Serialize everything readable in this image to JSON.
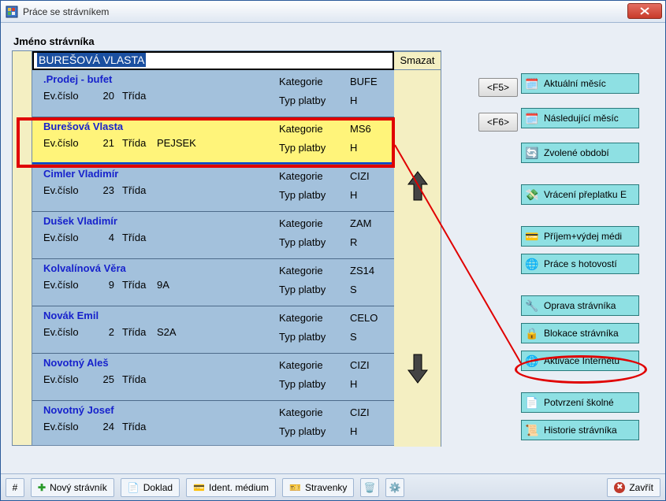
{
  "window": {
    "title": "Práce se strávníkem"
  },
  "sectionLabel": "Jméno strávníka",
  "searchValue": "BUREŠOVÁ VLASTA",
  "smazatLabel": "Smazat",
  "labels": {
    "ev": "Ev.číslo",
    "trida": "Třída",
    "kategorie": "Kategorie",
    "typplatby": "Typ platby"
  },
  "rows": [
    {
      "name": ".Prodej - bufet",
      "ev": "20",
      "trida": "",
      "kat": "BUFE",
      "typ": "H"
    },
    {
      "name": "Burešová Vlasta",
      "ev": "21",
      "trida": "PEJSEK",
      "kat": "MS6",
      "typ": "H",
      "selected": true
    },
    {
      "name": "Cimler Vladimír",
      "ev": "23",
      "trida": "",
      "kat": "CIZI",
      "typ": "H"
    },
    {
      "name": "Dušek Vladimír",
      "ev": "4",
      "trida": "",
      "kat": "ZAM",
      "typ": "R"
    },
    {
      "name": "Kolvalínová Věra",
      "ev": "9",
      "trida": "9A",
      "kat": "ZS14",
      "typ": "S"
    },
    {
      "name": "Novák Emil",
      "ev": "2",
      "trida": "S2A",
      "kat": "CELO",
      "typ": "S"
    },
    {
      "name": "Novotný  Aleš",
      "ev": "25",
      "trida": "",
      "kat": "CIZI",
      "typ": "H"
    },
    {
      "name": "Novotný Josef",
      "ev": "24",
      "trida": "",
      "kat": "CIZI",
      "typ": "H"
    }
  ],
  "keys": {
    "f5": "<F5>",
    "f6": "<F6>"
  },
  "actions": {
    "aktualni": "Aktuální měsíc",
    "nasledujici": "Následující měsíc",
    "zvolene": "Zvolené období",
    "vraceni": "Vrácení přeplatku E",
    "prijem": "Příjem+výdej médi",
    "hotovost": "Práce s hotovostí",
    "oprava": "Oprava strávníka",
    "blokace": "Blokace strávníka",
    "internet": "Aktivace Internetu",
    "potvrzeni": "Potvrzení školné",
    "historie": "Historie strávníka"
  },
  "toolbar": {
    "hash": "#",
    "novy": "Nový strávník",
    "doklad": "Doklad",
    "ident": "Ident. médium",
    "stravenky": "Stravenky",
    "zavrit": "Zavřít"
  }
}
